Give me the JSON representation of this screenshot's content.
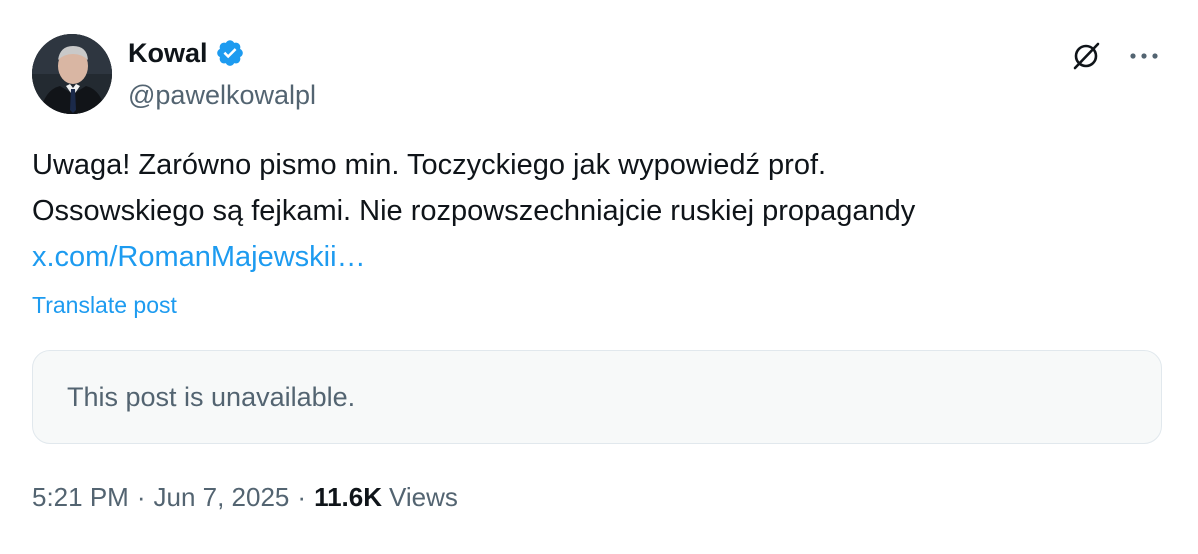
{
  "author": {
    "display_name": "Kowal",
    "handle": "@pawelkowalpl",
    "verified": true
  },
  "post": {
    "lines": [
      "Uwaga! Zarówno pismo min. Toczyckiego jak wypowiedź prof.",
      "Ossowskiego są fejkami. Nie rozpowszechniajcie ruskiej propagandy"
    ],
    "link_text": "x.com/RomanMajewskii…",
    "translate_label": "Translate post"
  },
  "quoted_post": {
    "unavailable_text": "This post is unavailable."
  },
  "meta": {
    "time": "5:21 PM",
    "separator": "·",
    "date": "Jun 7, 2025",
    "views_count": "11.6K",
    "views_label": "Views"
  },
  "icons": {
    "verified": "verified-badge-icon",
    "grok": "grok-icon",
    "more": "more-icon"
  },
  "colors": {
    "accent": "#1d9bf0",
    "text": "#0f1419",
    "secondary": "#536471"
  }
}
